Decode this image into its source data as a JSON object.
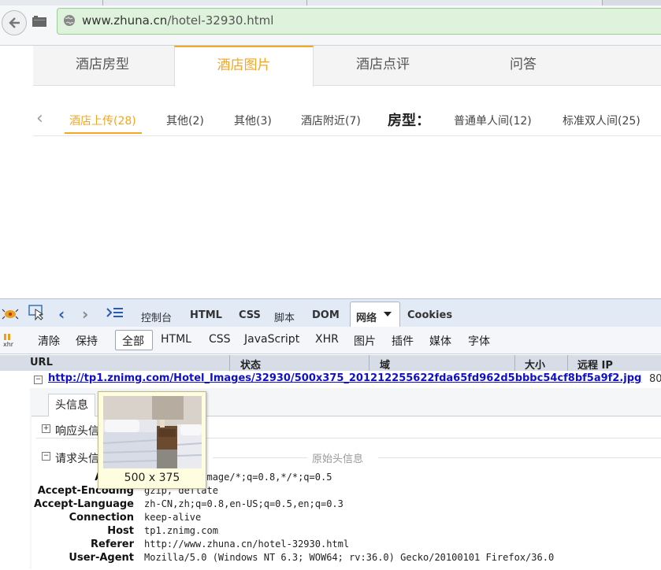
{
  "browser": {
    "url_host": "www.zhuna.cn",
    "url_path": "/hotel-32930.html"
  },
  "main_tabs": [
    {
      "label": "酒店房型",
      "active": false
    },
    {
      "label": "酒店图片",
      "active": true
    },
    {
      "label": "酒店点评",
      "active": false
    },
    {
      "label": "问答",
      "active": false
    }
  ],
  "sub_tabs": {
    "items": [
      "酒店上传(28)",
      "其他(2)",
      "其他(3)",
      "酒店附近(7)"
    ],
    "room_type_label": "房型：",
    "room_items": [
      "普通单人间(12)",
      "标准双人间(25)"
    ]
  },
  "firebug": {
    "panels": [
      "控制台",
      "HTML",
      "CSS",
      "脚本",
      "DOM",
      "网络",
      "Cookies"
    ],
    "active_panel": "网络",
    "actions": [
      "清除",
      "保持"
    ],
    "filters": [
      "全部",
      "HTML",
      "CSS",
      "JavaScript",
      "XHR",
      "图片",
      "插件",
      "媒体",
      "字体"
    ],
    "active_filter": "全部",
    "columns": [
      "URL",
      "状态",
      "域",
      "大小",
      "远程 IP"
    ],
    "request": {
      "url": "http://tp1.znimg.com/Hotel_Images/32930/500x375_201212255622fda65fd962d5bbbc54cf8bf5a9f2.jpg",
      "extra": "80"
    },
    "detail_tab": "头信息",
    "sections": {
      "response_headers": "响应头信息",
      "request_headers": "请求头信息",
      "raw_headers": "原始头信息"
    },
    "request_headers": [
      {
        "name": "Accept",
        "value": "image/png,image/*;q=0.8,*/*;q=0.5"
      },
      {
        "name": "Accept-Encoding",
        "value": "gzip, deflate"
      },
      {
        "name": "Accept-Language",
        "value": "zh-CN,zh;q=0.8,en-US;q=0.5,en;q=0.3"
      },
      {
        "name": "Connection",
        "value": "keep-alive"
      },
      {
        "name": "Host",
        "value": "tp1.znimg.com"
      },
      {
        "name": "Referer",
        "value": "http://www.zhuna.cn/hotel-32930.html"
      },
      {
        "name": "User-Agent",
        "value": "Mozilla/5.0 (Windows NT 6.3; WOW64; rv:36.0) Gecko/20100101 Firefox/36.0"
      }
    ],
    "tooltip": {
      "dimensions": "500 x 375"
    }
  },
  "colors": {
    "accent": "#f5a623",
    "link": "#1010c8",
    "url_bar": "#dff3dc"
  }
}
